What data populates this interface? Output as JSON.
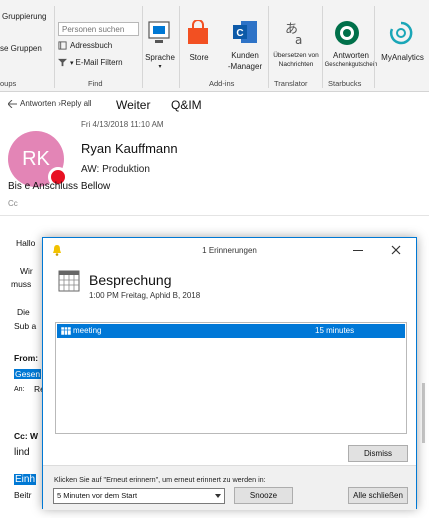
{
  "ribbon": {
    "grouping_label": "Gruppierung",
    "groups_label": "se Gruppen",
    "groups_footer": "oups",
    "search_people_placeholder": "Personen suchen",
    "address_book_label": "Adressbuch",
    "email_filter_label": "E-Mail Filtern",
    "find_footer": "Find",
    "speech_label": "Sprache",
    "store_label": "Store",
    "kunden_manager_label_1": "Kunden",
    "kunden_manager_label_2": "-Manager",
    "addins_footer": "Add-ins",
    "translate_label_1": "Übersetzen von",
    "translate_label_2": "Nachrichten",
    "translator_footer": "Translator",
    "starbucks_label_1": "Antworten",
    "starbucks_label_2": "Geschenkgutschein",
    "starbucks_footer": "Starbucks",
    "myanalytics_label": "MyAnalytics"
  },
  "message": {
    "response_text": "Antworten ›Reply all",
    "weiter": "Weiter",
    "qim": "Q&IM",
    "date": "Fri 4/13/2018 11:10 AM",
    "avatar_initials": "RK",
    "sender": "Ryan Kauffmann",
    "aw": "AW: Produktion",
    "subject": "Bis e Anschluss Bellow",
    "cc": "Cc",
    "body": {
      "hallo": "Hallo",
      "wir": "Wir",
      "muss": "muss",
      "die": "Die",
      "sub": "Sub a",
      "from": "From:",
      "gesen": "Gesen",
      "an": "An:",
      "re": "Re",
      "ccw": "Cc: W",
      "lind": "lind",
      "einh": "Einh",
      "beitr": "Beitr"
    }
  },
  "reminder": {
    "window_title": "1 Erinnerungen",
    "appointment_title": "Besprechung",
    "appointment_time": "1:00 PM Freitag, Aphid B, 2018",
    "items": [
      {
        "subject": "meeting",
        "due_in": "15 minutes"
      }
    ],
    "dismiss_label": "Dismiss",
    "hint": "Klicken Sie auf \"Erneut erinnern\", um erneut erinnert zu werden in:",
    "snooze_option": "5 Minuten vor dem Start",
    "snooze_label": "Snooze",
    "dismiss_all_label": "Alle schließen"
  },
  "colors": {
    "accent": "#0078d4",
    "avatar_bg": "#e385b6",
    "presence_busy": "#e81123",
    "store_orange": "#f25022",
    "starbucks_green": "#00704a"
  }
}
